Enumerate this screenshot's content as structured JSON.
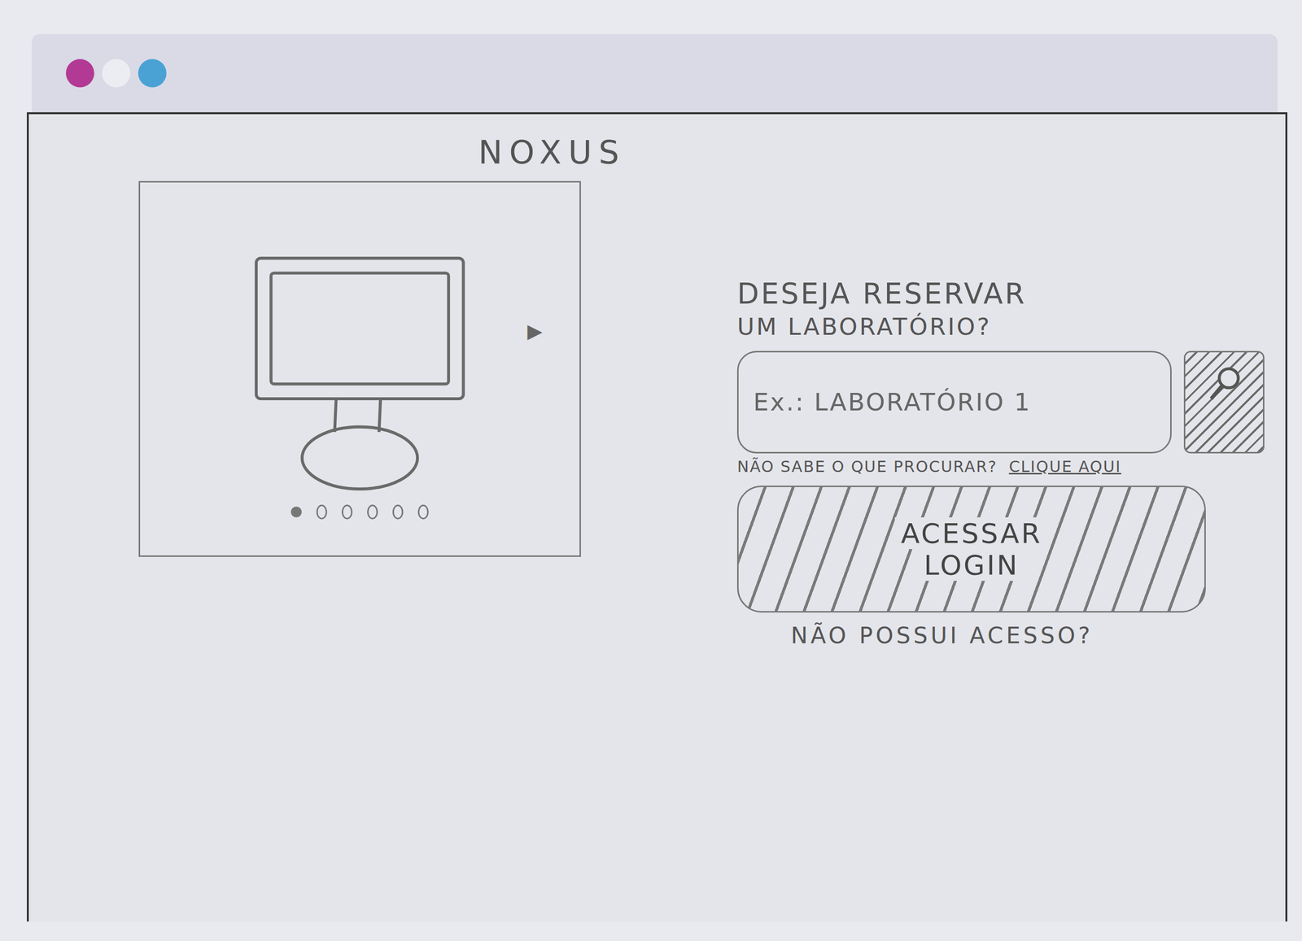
{
  "app": {
    "title": "NOXUS"
  },
  "carousel": {
    "next_icon": "▶",
    "dots": [
      {
        "selected": true
      },
      {
        "selected": false
      },
      {
        "selected": false
      },
      {
        "selected": false
      },
      {
        "selected": false
      },
      {
        "selected": false
      }
    ]
  },
  "prompt": {
    "lines": [
      "DESEJA RESERVAR",
      "UM LABORATÓRIO?"
    ]
  },
  "search": {
    "placeholder": "Ex.: LABORATÓRIO 1"
  },
  "help": {
    "text": "NÃO SABE O QUE PROCURAR?",
    "link": "CLIQUE AQUI"
  },
  "login_button": {
    "lines": [
      "ACESSAR",
      "LOGIN"
    ]
  },
  "no_access": {
    "text": "NÃO POSSUI ACESSO?"
  }
}
